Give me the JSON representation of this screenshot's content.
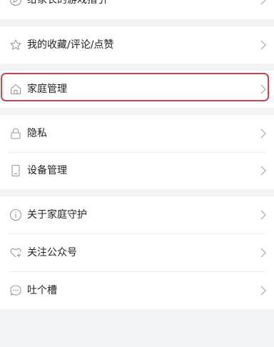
{
  "menu": {
    "item_game_guide": "给家长的游戏指引",
    "item_favorites": "我的收藏/评论/点赞",
    "item_family": "家庭管理",
    "item_privacy": "隐私",
    "item_devices": "设备管理",
    "item_about": "关于家庭守护",
    "item_follow": "关注公众号",
    "item_feedback": "吐个槽"
  },
  "colors": {
    "highlight_border": "#c9434f",
    "icon_stroke": "#9a9a9a",
    "page_background": "#f2f3f5"
  }
}
